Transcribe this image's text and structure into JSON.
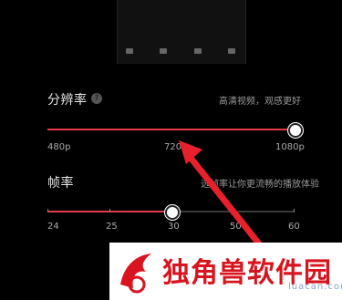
{
  "resolution": {
    "label": "分辨率",
    "help_icon": "question-circle-icon",
    "hint": "高清视频，观感更好",
    "ticks": [
      "480p",
      "720p",
      "1080p"
    ],
    "selected": "1080p",
    "fill_fraction": 1.0
  },
  "framerate": {
    "label": "帧率",
    "hint": "选帧率让你更流畅的播放体验",
    "ticks": [
      "24",
      "25",
      "30",
      "50",
      "60"
    ],
    "selected": "30",
    "fill_fraction": 0.5
  },
  "watermark": {
    "text": "独角兽软件园",
    "url": "luacan.com"
  },
  "colors": {
    "accent": "#e83a4a",
    "watermark": "#d8141e"
  }
}
